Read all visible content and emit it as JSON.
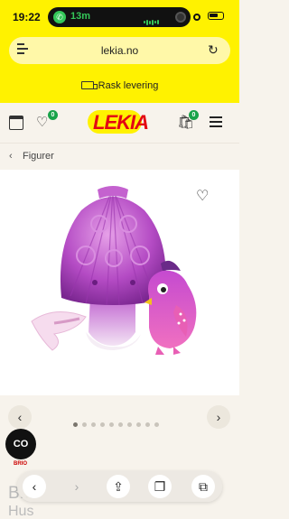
{
  "status_bar": {
    "time": "19:22",
    "call_timer": "13m"
  },
  "browser": {
    "url": "lekia.no"
  },
  "banner": {
    "delivery_text": "Rask levering"
  },
  "header": {
    "logo_text": "LEKIA",
    "wishlist_count": "0",
    "cart_count": "0"
  },
  "breadcrumb": {
    "label": "Figurer"
  },
  "carousel": {
    "total_dots": 10,
    "active_index": 0
  },
  "brand_button": {
    "label": "CO",
    "brand": "BRIO"
  },
  "product": {
    "title_line1": "B...",
    "title_line2": "Hus"
  },
  "colors": {
    "brand_yellow": "#fff200",
    "brand_red": "#e30613",
    "badge_green": "#19a34a"
  }
}
